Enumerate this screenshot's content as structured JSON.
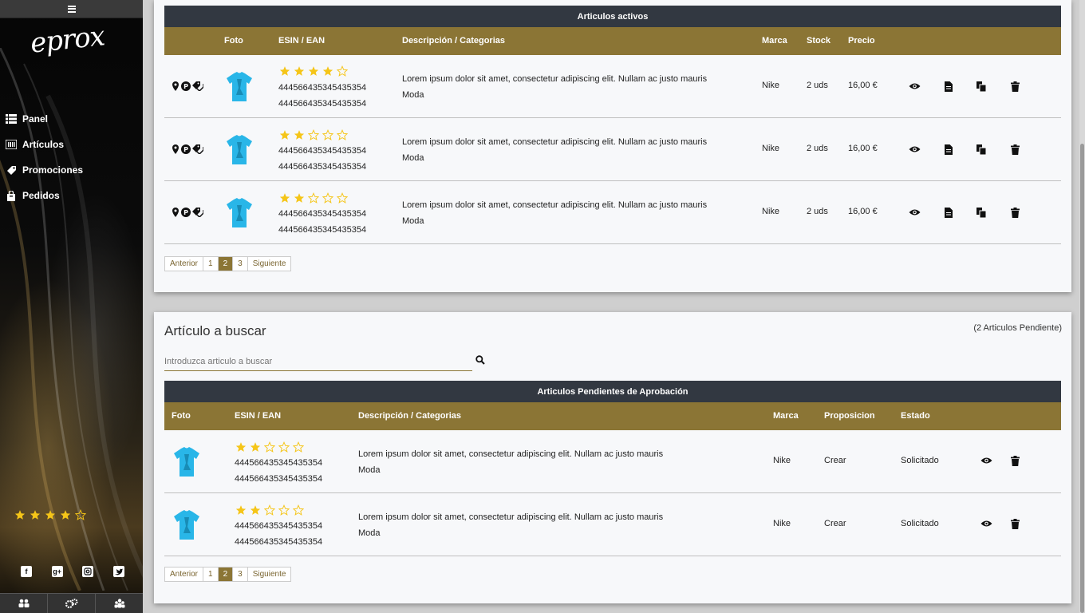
{
  "sidebar": {
    "logo_text": "eprox",
    "nav": [
      {
        "label": "Panel",
        "icon": "list-icon"
      },
      {
        "label": "Artículos",
        "icon": "barcode-icon"
      },
      {
        "label": "Promociones",
        "icon": "tag-icon"
      },
      {
        "label": "Pedidos",
        "icon": "shopping-bag-icon"
      }
    ],
    "rating": 4,
    "rating_max": 5,
    "socials": [
      "facebook-icon",
      "google-plus-icon",
      "instagram-icon",
      "twitter-icon"
    ],
    "bottom_tabs": [
      "users-group-icon",
      "settings-gears-icon",
      "people-icon"
    ]
  },
  "active_table": {
    "title": "Articulos activos",
    "headers": [
      "Foto",
      "ESIN / EAN",
      "Descripción / Categorias",
      "Marca",
      "Stock",
      "Precio"
    ],
    "rows": [
      {
        "rating": 4,
        "code1": "444566435345435354",
        "code2": "444566435345435354",
        "desc": "Lorem ipsum dolor sit amet, consectetur adipiscing elit. Nullam ac justo mauris",
        "category": "Moda",
        "brand": "Nike",
        "stock": "2 uds",
        "price": "16,00 €"
      },
      {
        "rating": 2,
        "code1": "444566435345435354",
        "code2": "444566435345435354",
        "desc": "Lorem ipsum dolor sit amet, consectetur adipiscing elit. Nullam ac justo mauris",
        "category": "Moda",
        "brand": "Nike",
        "stock": "2 uds",
        "price": "16,00 €"
      },
      {
        "rating": 2,
        "code1": "444566435345435354",
        "code2": "444566435345435354",
        "desc": "Lorem ipsum dolor sit amet, consectetur adipiscing elit. Nullam ac justo mauris",
        "category": "Moda",
        "brand": "Nike",
        "stock": "2 uds",
        "price": "16,00 €"
      }
    ],
    "pagination": {
      "prev": "Anterior",
      "pages": [
        "1",
        "2",
        "3"
      ],
      "active": "2",
      "next": "Siguiente"
    }
  },
  "search_section": {
    "title": "Artículo a buscar",
    "pending_count": "(2 Articulos Pendiente)",
    "placeholder": "Introduzca articulo a buscar"
  },
  "pending_table": {
    "title": "Articulos Pendientes de Aprobación",
    "headers": [
      "Foto",
      "ESIN / EAN",
      "Descripción / Categorias",
      "Marca",
      "Proposicion",
      "Estado"
    ],
    "rows": [
      {
        "rating": 2,
        "code1": "444566435345435354",
        "code2": "444566435345435354",
        "desc": "Lorem ipsum dolor sit amet, consectetur adipiscing elit. Nullam ac justo mauris",
        "category": "Moda",
        "brand": "Nike",
        "proposal": "Crear",
        "status": "Solicitado"
      },
      {
        "rating": 2,
        "code1": "444566435345435354",
        "code2": "444566435345435354",
        "desc": "Lorem ipsum dolor sit amet, consectetur adipiscing elit. Nullam ac justo mauris",
        "category": "Moda",
        "brand": "Nike",
        "proposal": "Crear",
        "status": "Solicitado"
      }
    ],
    "pagination": {
      "prev": "Anterior",
      "pages": [
        "1",
        "2",
        "3"
      ],
      "active": "2",
      "next": "Siguiente"
    }
  },
  "colors": {
    "accent": "#8b7535",
    "header_dark": "#323841",
    "star": "#f5c518",
    "shirt": "#29b6e8"
  }
}
